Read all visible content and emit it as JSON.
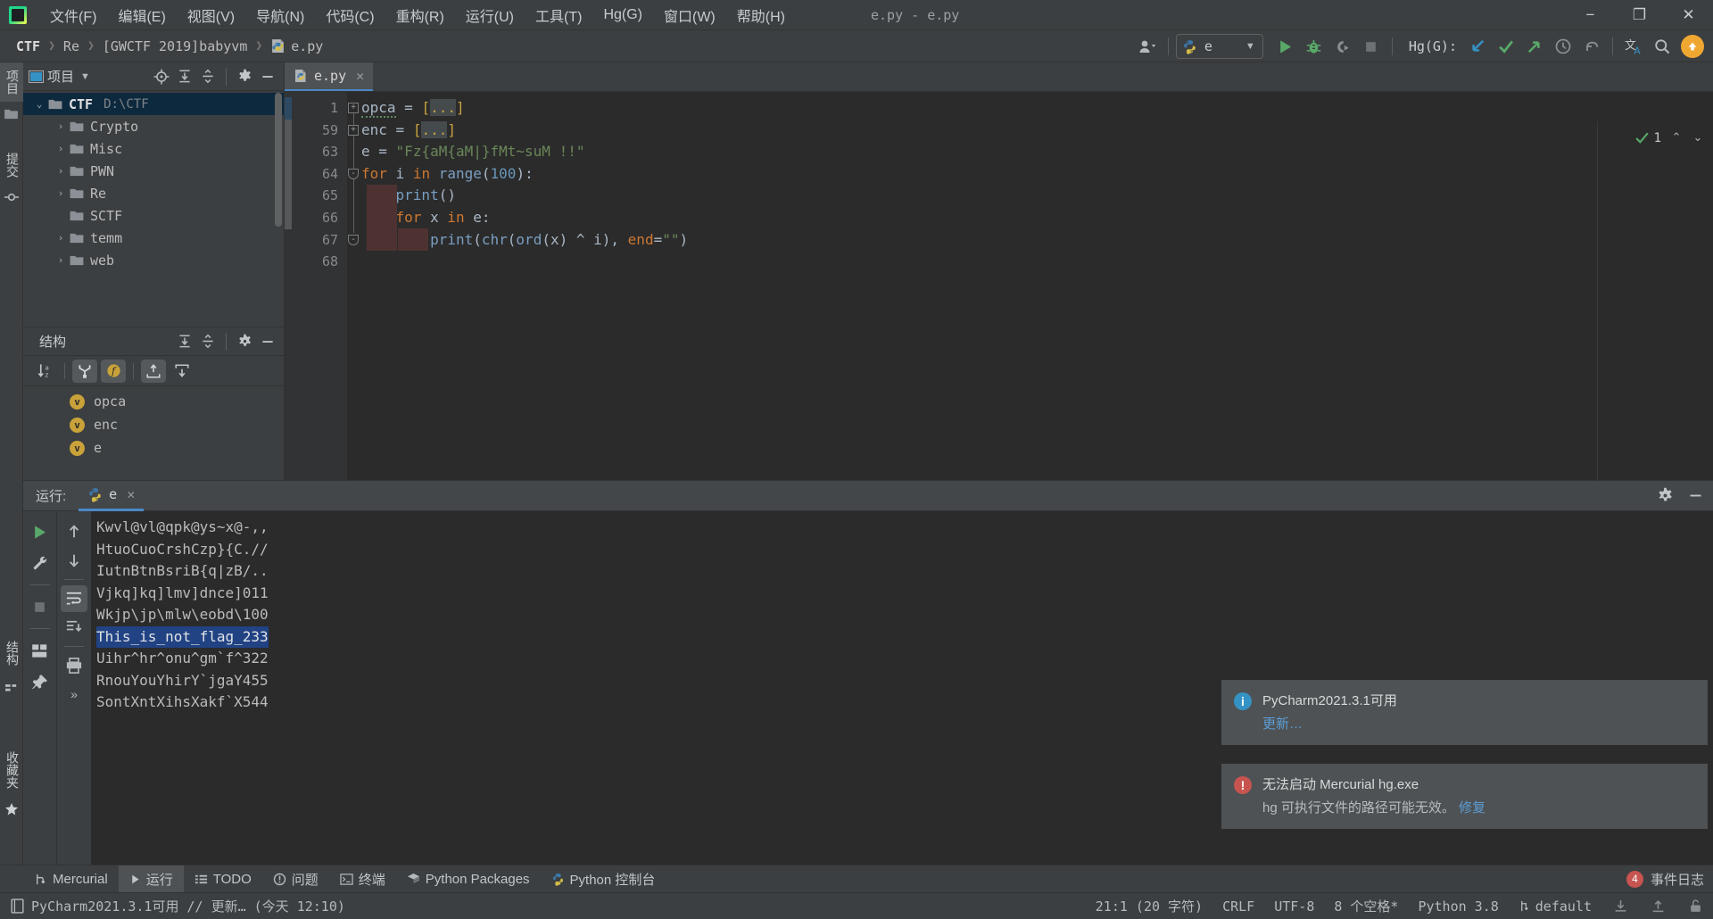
{
  "window": {
    "title": "e.py - e.py",
    "minimize": "−",
    "maximize": "❐",
    "close": "✕"
  },
  "menu": [
    {
      "label": "文件(F)",
      "name": "menu-file"
    },
    {
      "label": "编辑(E)",
      "name": "menu-edit"
    },
    {
      "label": "视图(V)",
      "name": "menu-view"
    },
    {
      "label": "导航(N)",
      "name": "menu-navigate"
    },
    {
      "label": "代码(C)",
      "name": "menu-code"
    },
    {
      "label": "重构(R)",
      "name": "menu-refactor"
    },
    {
      "label": "运行(U)",
      "name": "menu-run"
    },
    {
      "label": "工具(T)",
      "name": "menu-tools"
    },
    {
      "label": "Hg(G)",
      "name": "menu-hg"
    },
    {
      "label": "窗口(W)",
      "name": "menu-window"
    },
    {
      "label": "帮助(H)",
      "name": "menu-help"
    }
  ],
  "breadcrumb": [
    {
      "label": "CTF"
    },
    {
      "label": "Re"
    },
    {
      "label": "[GWCTF 2019]babyvm"
    },
    {
      "label": "e.py"
    }
  ],
  "toolbar": {
    "run_config_name": "e",
    "hg_label": "Hg(G):",
    "dropdown_glyph": "▼"
  },
  "left_strip": {
    "project_tab": "项目",
    "commit_tab": "提交"
  },
  "left_strip_bottom": {
    "structure_tab": "结构",
    "favorites_tab": "收藏夹"
  },
  "project_panel": {
    "title": "项目",
    "tree": [
      {
        "label": "CTF",
        "path": "D:\\CTF",
        "depth": 0,
        "arrow": "⌄",
        "bold": true,
        "selected": true
      },
      {
        "label": "Crypto",
        "path": "",
        "depth": 1,
        "arrow": "›",
        "bold": false,
        "selected": false
      },
      {
        "label": "Misc",
        "path": "",
        "depth": 1,
        "arrow": "›",
        "bold": false,
        "selected": false
      },
      {
        "label": "PWN",
        "path": "",
        "depth": 1,
        "arrow": "›",
        "bold": false,
        "selected": false
      },
      {
        "label": "Re",
        "path": "",
        "depth": 1,
        "arrow": "›",
        "bold": false,
        "selected": false
      },
      {
        "label": "SCTF",
        "path": "",
        "depth": 1,
        "arrow": "",
        "bold": false,
        "selected": false
      },
      {
        "label": "temm",
        "path": "",
        "depth": 1,
        "arrow": "›",
        "bold": false,
        "selected": false
      },
      {
        "label": "web",
        "path": "",
        "depth": 1,
        "arrow": "›",
        "bold": false,
        "selected": false
      }
    ]
  },
  "structure_panel": {
    "title": "结构",
    "items": [
      {
        "label": "opca",
        "kind": "v"
      },
      {
        "label": "enc",
        "kind": "v"
      },
      {
        "label": "e",
        "kind": "v"
      }
    ]
  },
  "editor": {
    "tab_label": "e.py",
    "tab_close": "✕",
    "inspection_count": "1",
    "lines": [
      {
        "num": "1",
        "fold": "+",
        "tokens": [
          {
            "t": "opca",
            "c": "k-plain squig"
          },
          {
            "t": " = ",
            "c": "k-plain"
          },
          {
            "t": "[",
            "c": "k-fold-b"
          },
          {
            "t": "...",
            "c": "k-fold"
          },
          {
            "t": "]",
            "c": "k-fold-b"
          }
        ]
      },
      {
        "num": "59",
        "fold": "+",
        "tokens": [
          {
            "t": "enc",
            "c": "k-plain"
          },
          {
            "t": " = ",
            "c": "k-plain"
          },
          {
            "t": "[",
            "c": "k-fold-b"
          },
          {
            "t": "...",
            "c": "k-fold"
          },
          {
            "t": "]",
            "c": "k-fold-b"
          }
        ]
      },
      {
        "num": "63",
        "fold": "",
        "tokens": [
          {
            "t": "e",
            "c": "k-plain"
          },
          {
            "t": " = ",
            "c": "k-plain"
          },
          {
            "t": "\"Fz{aM{aM|}fMt~suM !!\"",
            "c": "k-str"
          }
        ]
      },
      {
        "num": "64",
        "fold": "-",
        "tokens": [
          {
            "t": "for",
            "c": "k-kw"
          },
          {
            "t": " i ",
            "c": "k-plain"
          },
          {
            "t": "in",
            "c": "k-kw"
          },
          {
            "t": " ",
            "c": "k-plain"
          },
          {
            "t": "range",
            "c": "k-fn"
          },
          {
            "t": "(",
            "c": "k-par"
          },
          {
            "t": "100",
            "c": "k-num"
          },
          {
            "t": "):",
            "c": "k-par"
          }
        ]
      },
      {
        "num": "65",
        "fold": "",
        "tokens": [
          {
            "t": "    ",
            "c": "k-plain"
          },
          {
            "t": "print",
            "c": "k-fn"
          },
          {
            "t": "()",
            "c": "k-par"
          }
        ]
      },
      {
        "num": "66",
        "fold": "",
        "tokens": [
          {
            "t": "    ",
            "c": "k-plain"
          },
          {
            "t": "for",
            "c": "k-kw"
          },
          {
            "t": " x ",
            "c": "k-plain"
          },
          {
            "t": "in",
            "c": "k-kw"
          },
          {
            "t": " e:",
            "c": "k-plain"
          }
        ]
      },
      {
        "num": "67",
        "fold": "-",
        "tokens": [
          {
            "t": "        ",
            "c": "k-plain"
          },
          {
            "t": "print",
            "c": "k-fn"
          },
          {
            "t": "(",
            "c": "k-par"
          },
          {
            "t": "chr",
            "c": "k-fn"
          },
          {
            "t": "(",
            "c": "k-par"
          },
          {
            "t": "ord",
            "c": "k-fn"
          },
          {
            "t": "(x) ",
            "c": "k-par"
          },
          {
            "t": "^",
            "c": "k-plain"
          },
          {
            "t": " i), ",
            "c": "k-par"
          },
          {
            "t": "end",
            "c": "k-kw"
          },
          {
            "t": "=",
            "c": "k-plain"
          },
          {
            "t": "\"\"",
            "c": "k-str"
          },
          {
            "t": ")",
            "c": "k-par"
          }
        ]
      },
      {
        "num": "68",
        "fold": "",
        "tokens": []
      }
    ]
  },
  "run_panel": {
    "label": "运行:",
    "tab_label": "e",
    "tab_close": "✕",
    "console_lines": [
      {
        "text": "Kwvl@vl@qpk@ys~x@-,,",
        "selected": false
      },
      {
        "text": "HtuoCuoCrshCzp}{C.//",
        "selected": false
      },
      {
        "text": "IutnBtnBsriB{q|zB/..",
        "selected": false
      },
      {
        "text": "Vjkq]kq]lmv]dnce]011",
        "selected": false
      },
      {
        "text": "Wkjp\\jp\\mlw\\eobd\\100",
        "selected": false
      },
      {
        "text": "This_is_not_flag_233",
        "selected": true
      },
      {
        "text": "Uihr^hr^onu^gm`f^322",
        "selected": false
      },
      {
        "text": "RnouYouYhirY`jgaY455",
        "selected": false
      },
      {
        "text": "SontXntXihsXakf`X544",
        "selected": false
      }
    ]
  },
  "notifications": [
    {
      "type": "info",
      "icon_glyph": "i",
      "icon_color": "#3592c4",
      "title": "PyCharm2021.3.1可用",
      "link": "更新…",
      "sub": ""
    },
    {
      "type": "error",
      "icon_glyph": "!",
      "icon_color": "#c75450",
      "title": "无法启动 Mercurial hg.exe",
      "link": "修复",
      "sub": "hg 可执行文件的路径可能无效。"
    }
  ],
  "tool_windows": [
    {
      "label": "Mercurial",
      "icon": "branch-icon",
      "active": false
    },
    {
      "label": "运行",
      "icon": "play-icon",
      "active": true
    },
    {
      "label": "TODO",
      "icon": "list-icon",
      "active": false
    },
    {
      "label": "问题",
      "icon": "warning-icon",
      "active": false
    },
    {
      "label": "终端",
      "icon": "terminal-icon",
      "active": false
    },
    {
      "label": "Python Packages",
      "icon": "packages-icon",
      "active": false
    },
    {
      "label": "Python 控制台",
      "icon": "python-icon",
      "active": false
    }
  ],
  "event_log": {
    "badge_count": "4",
    "label": "事件日志"
  },
  "statusbar": {
    "message": "PyCharm2021.3.1可用 // 更新… (今天 12:10)",
    "caret": "21:1 (20 字符)",
    "line_sep": "CRLF",
    "encoding": "UTF-8",
    "indent": "8 个空格*",
    "interpreter": "Python 3.8",
    "branch": "default"
  },
  "colors": {
    "accent_blue": "#4a88c7",
    "selection_blue": "#214283",
    "tree_selection": "#0d293e",
    "editor_bg": "#2b2b2b",
    "panel_bg": "#3c3f41",
    "string_green": "#6a8759",
    "keyword_orange": "#cc7832",
    "number_blue": "#6897bb",
    "update_orange": "#f0a732",
    "error_red": "#c75450"
  }
}
